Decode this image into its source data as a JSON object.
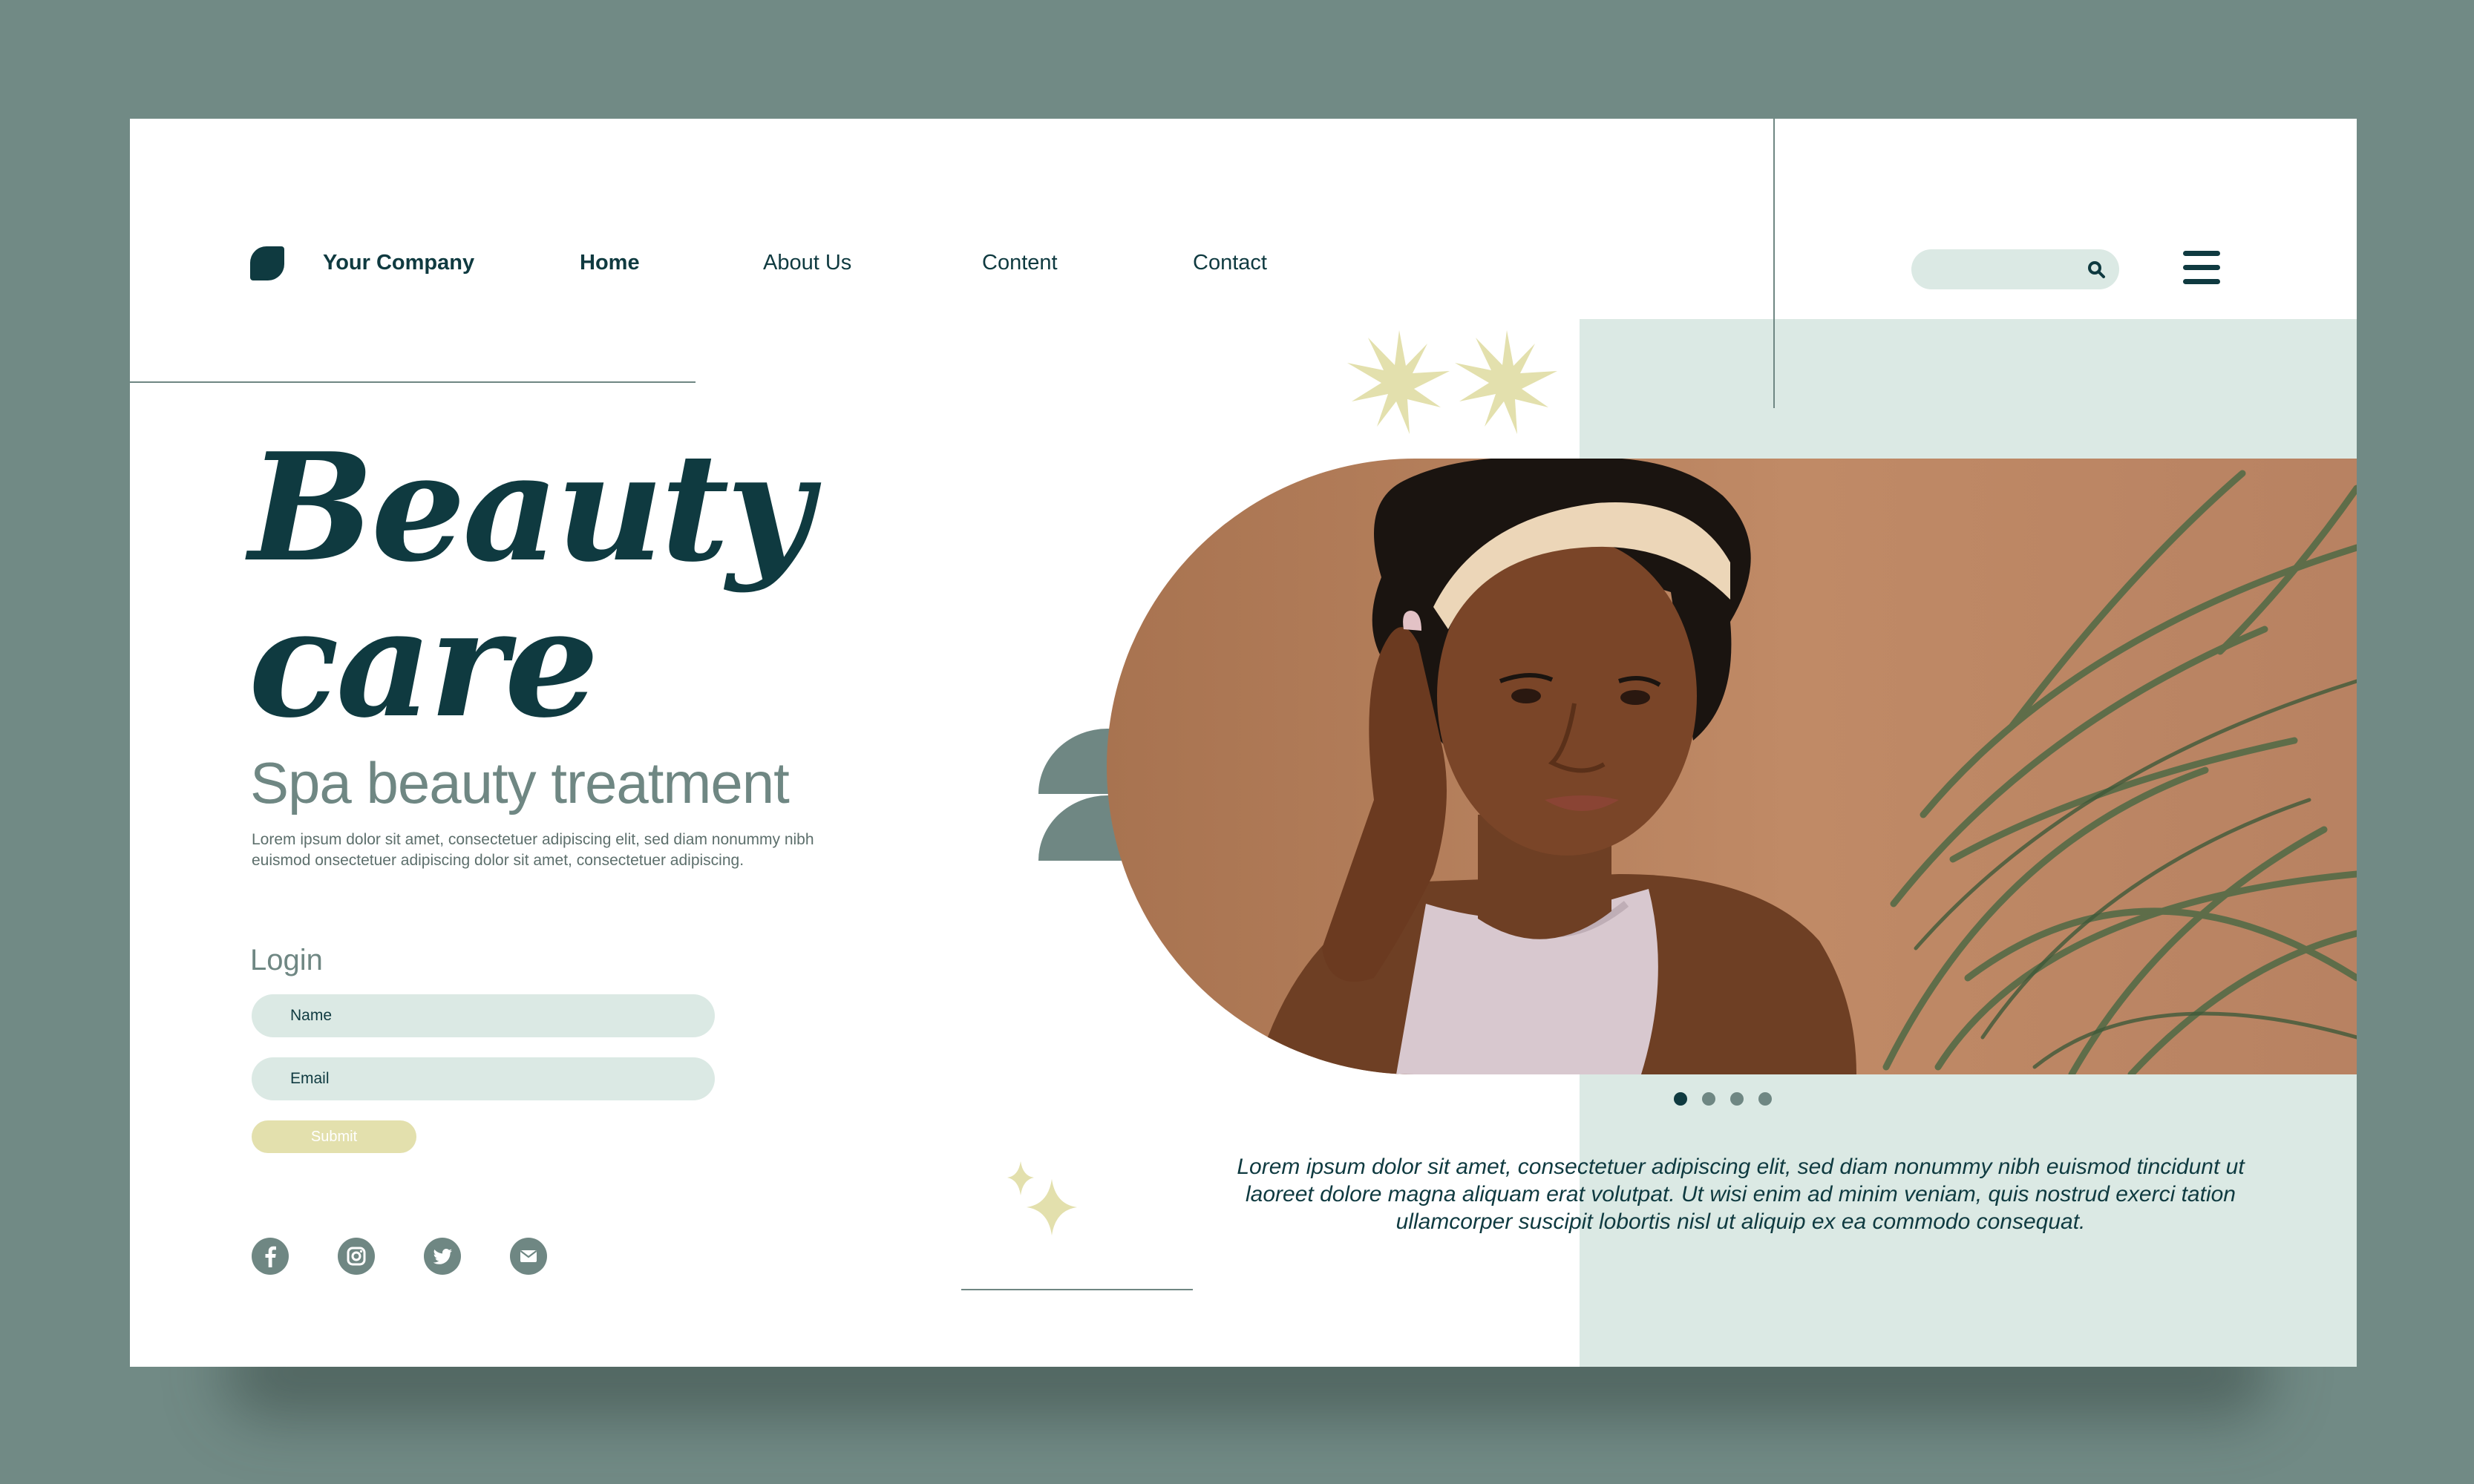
{
  "brand": {
    "name": "Your Company"
  },
  "nav": {
    "items": [
      {
        "label": "Home"
      },
      {
        "label": "About Us"
      },
      {
        "label": "Content"
      },
      {
        "label": "Contact"
      }
    ]
  },
  "search": {
    "placeholder": ""
  },
  "hero": {
    "title_line1": "Beauty",
    "title_line2": "care",
    "subtitle": "Spa beauty treatment",
    "description": "Lorem ipsum dolor sit amet, consectetuer adipiscing elit, sed diam nonummy nibh euismod onsectetuer adipiscing dolor sit amet, consectetuer adipiscing."
  },
  "login": {
    "title": "Login",
    "name_placeholder": "Name",
    "email_placeholder": "Email",
    "submit_label": "Submit"
  },
  "social": {
    "icons": [
      "facebook-icon",
      "instagram-icon",
      "twitter-icon",
      "email-icon"
    ]
  },
  "carousel": {
    "count": 4,
    "active": 1
  },
  "caption": "Lorem ipsum dolor sit amet, consectetuer adipiscing elit, sed diam nonummy nibh euismod tincidunt ut laoreet dolore magna aliquam erat volutpat. Ut wisi enim ad minim veniam, quis nostrud exerci tation ullamcorper suscipit lobortis nisl ut aliquip ex ea commodo consequat.",
  "colors": {
    "background": "#718a85",
    "dark": "#0f3a40",
    "muted": "#6f8783",
    "mint": "#dbe9e4",
    "cream": "#e3e0ad"
  }
}
